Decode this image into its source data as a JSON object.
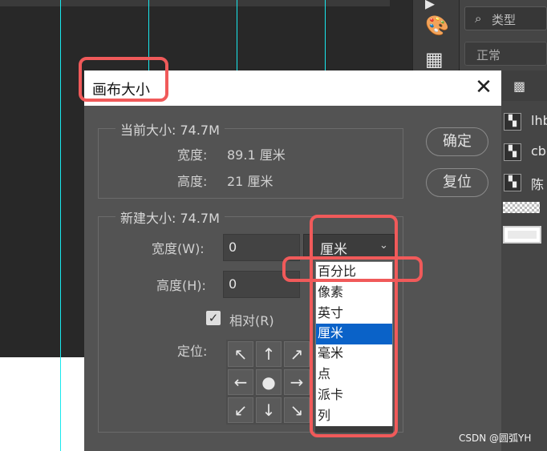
{
  "panel": {
    "search_placeholder": "类型",
    "blend_mode": "正常",
    "layers": [
      {
        "name": "lhb"
      },
      {
        "name": "cbc"
      },
      {
        "name": "陈"
      }
    ]
  },
  "dialog": {
    "title": "画布大小",
    "current_size": {
      "legend": "当前大小: 74.7M",
      "width_label": "宽度:",
      "width_value": "89.1 厘米",
      "height_label": "高度:",
      "height_value": "21 厘米"
    },
    "new_size": {
      "legend": "新建大小: 74.7M",
      "width_label": "宽度(W):",
      "width_value": "0",
      "height_label": "高度(H):",
      "height_value": "0",
      "unit_selected": "厘米",
      "relative_label": "相对(R)",
      "relative_checked": true,
      "anchor_label": "定位:"
    },
    "ok_label": "确定",
    "reset_label": "复位",
    "unit_options": [
      "百分比",
      "像素",
      "英寸",
      "厘米",
      "毫米",
      "点",
      "派卡",
      "列"
    ],
    "selected_unit_index": 3
  },
  "watermark": "CSDN @圆弧YH",
  "colors": {
    "highlight": "#f05a5a",
    "guide": "#19e8ee",
    "selection": "#0a62c8"
  }
}
